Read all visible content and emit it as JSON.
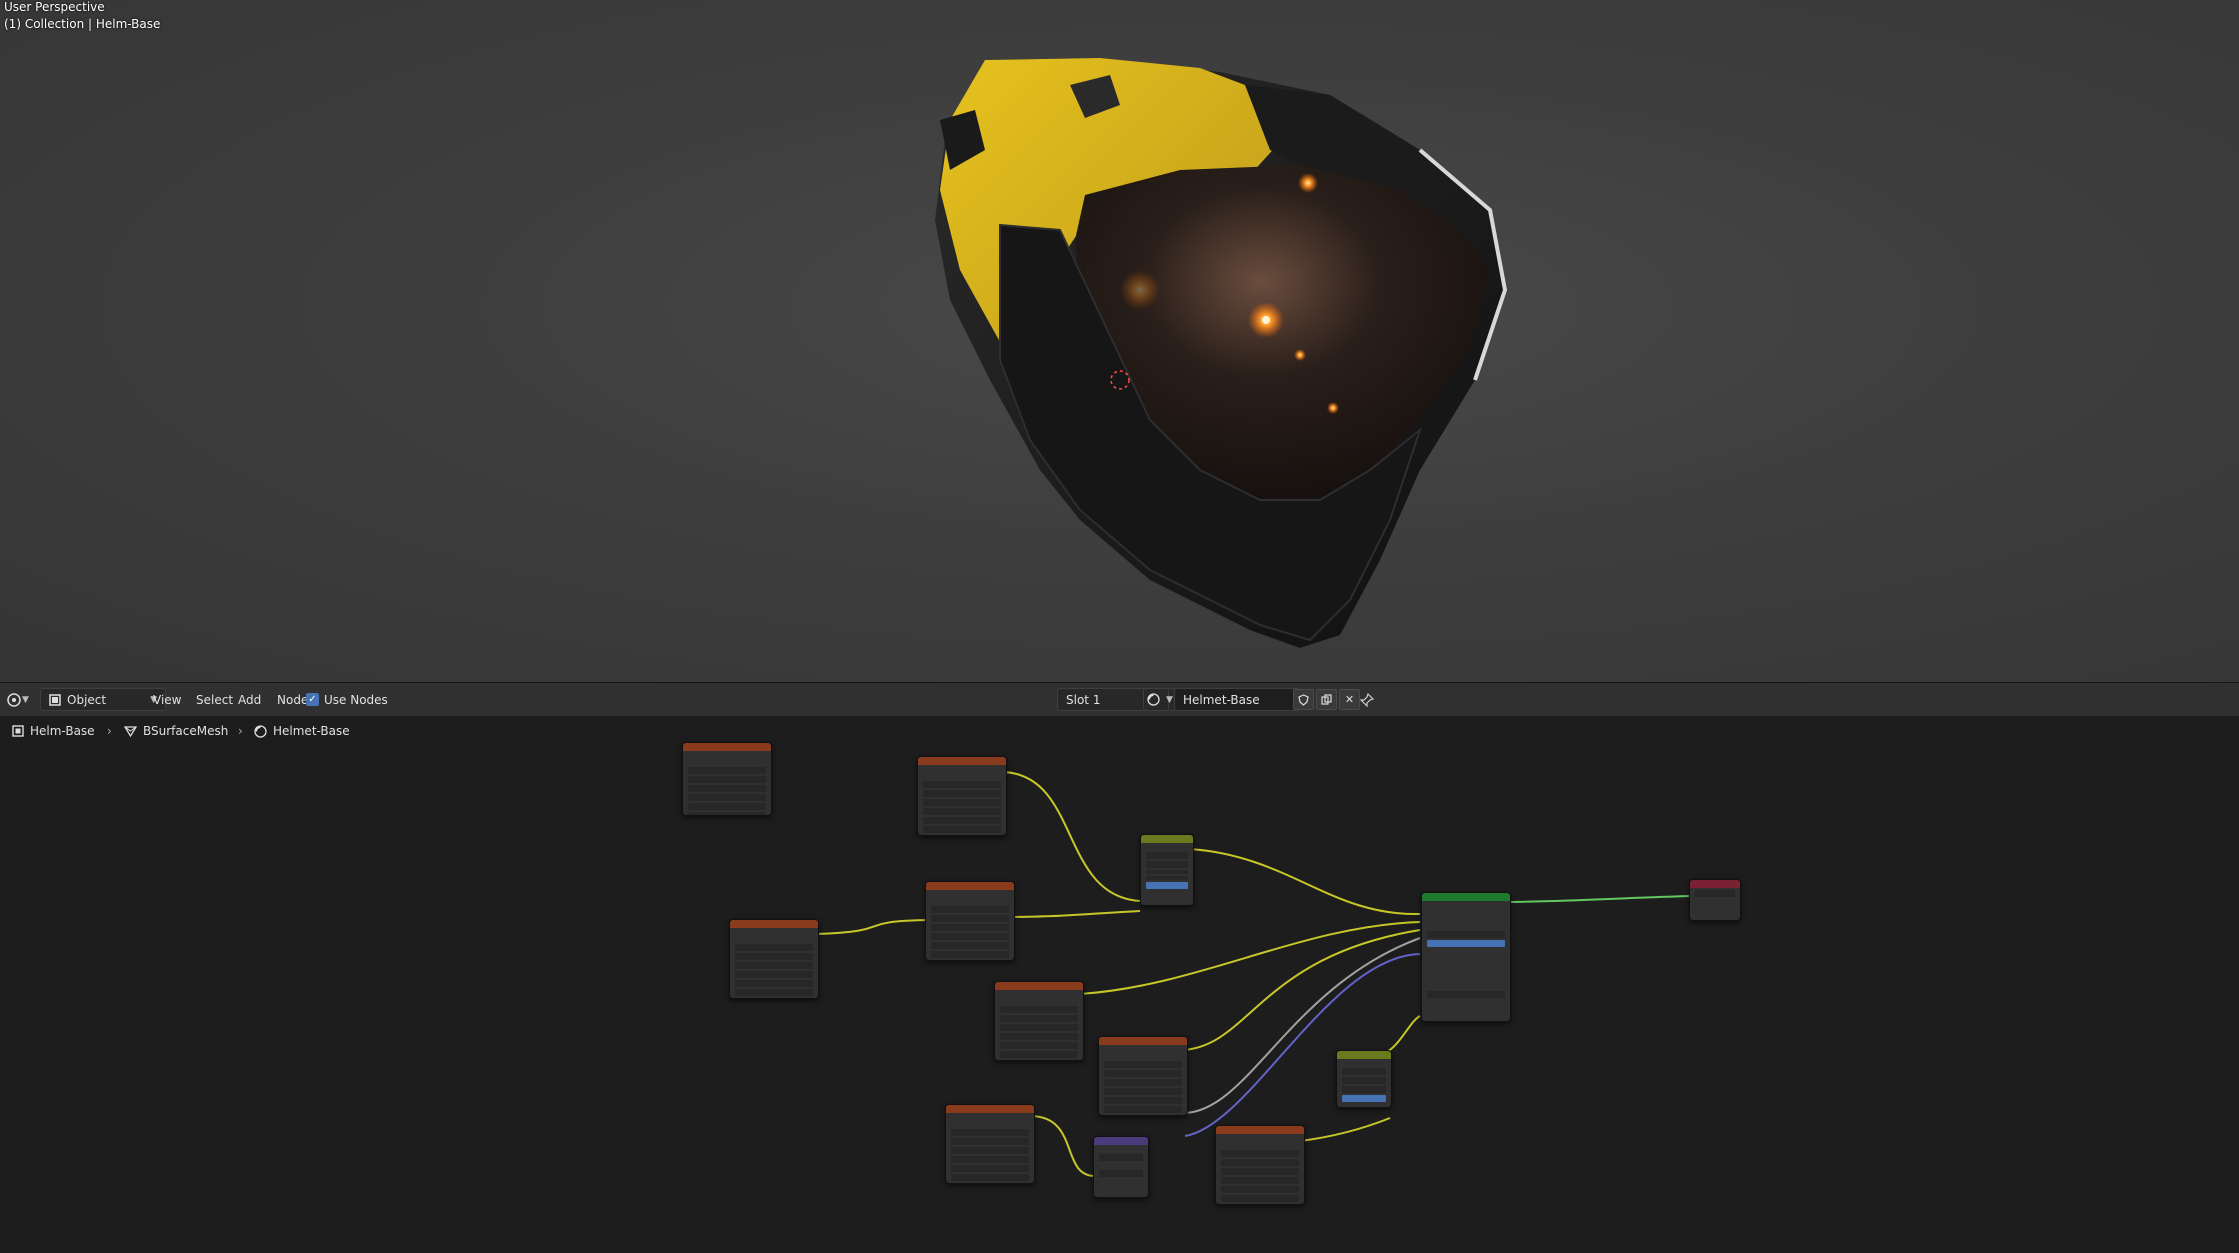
{
  "viewport": {
    "perspective_label": "User Perspective",
    "collection_label": "(1) Collection | Helm-Base"
  },
  "header": {
    "editor_type_icon": "node-editor-icon",
    "mode": "Object",
    "menus": [
      "View",
      "Select",
      "Add",
      "Node"
    ],
    "use_nodes_label": "Use Nodes",
    "use_nodes_checked": true,
    "slot": "Slot 1",
    "material_name": "Helmet-Base"
  },
  "breadcrumb": {
    "object": "Helm-Base",
    "mesh": "BSurfaceMesh",
    "material": "Helmet-Base"
  },
  "colors": {
    "texture_header": "#8a3b1e",
    "converter_header": "#6a7a1e",
    "shader_header": "#1f7a2f",
    "output_header": "#7a2233",
    "socket_color": "#c7c729",
    "socket_float": "#a1a1a1",
    "socket_vector": "#6363c7",
    "socket_shader": "#63c763"
  }
}
